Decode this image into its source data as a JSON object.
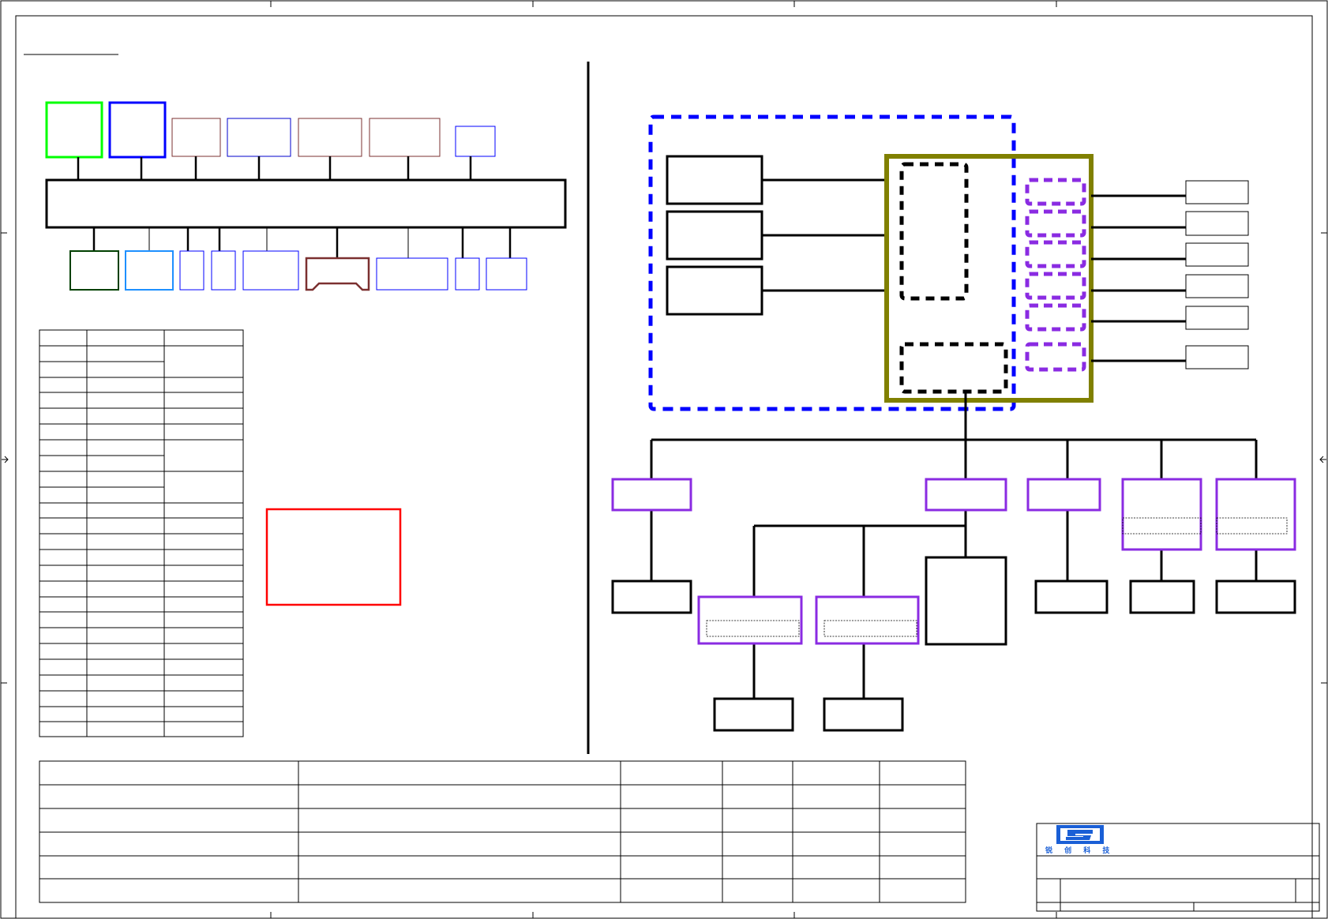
{
  "colors": {
    "frame": "#000000",
    "gnd_island": "#0000ff",
    "main_chip": "#808000",
    "power_rail": "#8a2be2",
    "memory_block": "#00ff00",
    "alert_box": "#ff0000",
    "connector_brown": "#7b3030",
    "logo_blue": "#1a5fd6"
  },
  "logo": {
    "name": "company-logo",
    "glyph_text": "锐 创 科 技"
  }
}
